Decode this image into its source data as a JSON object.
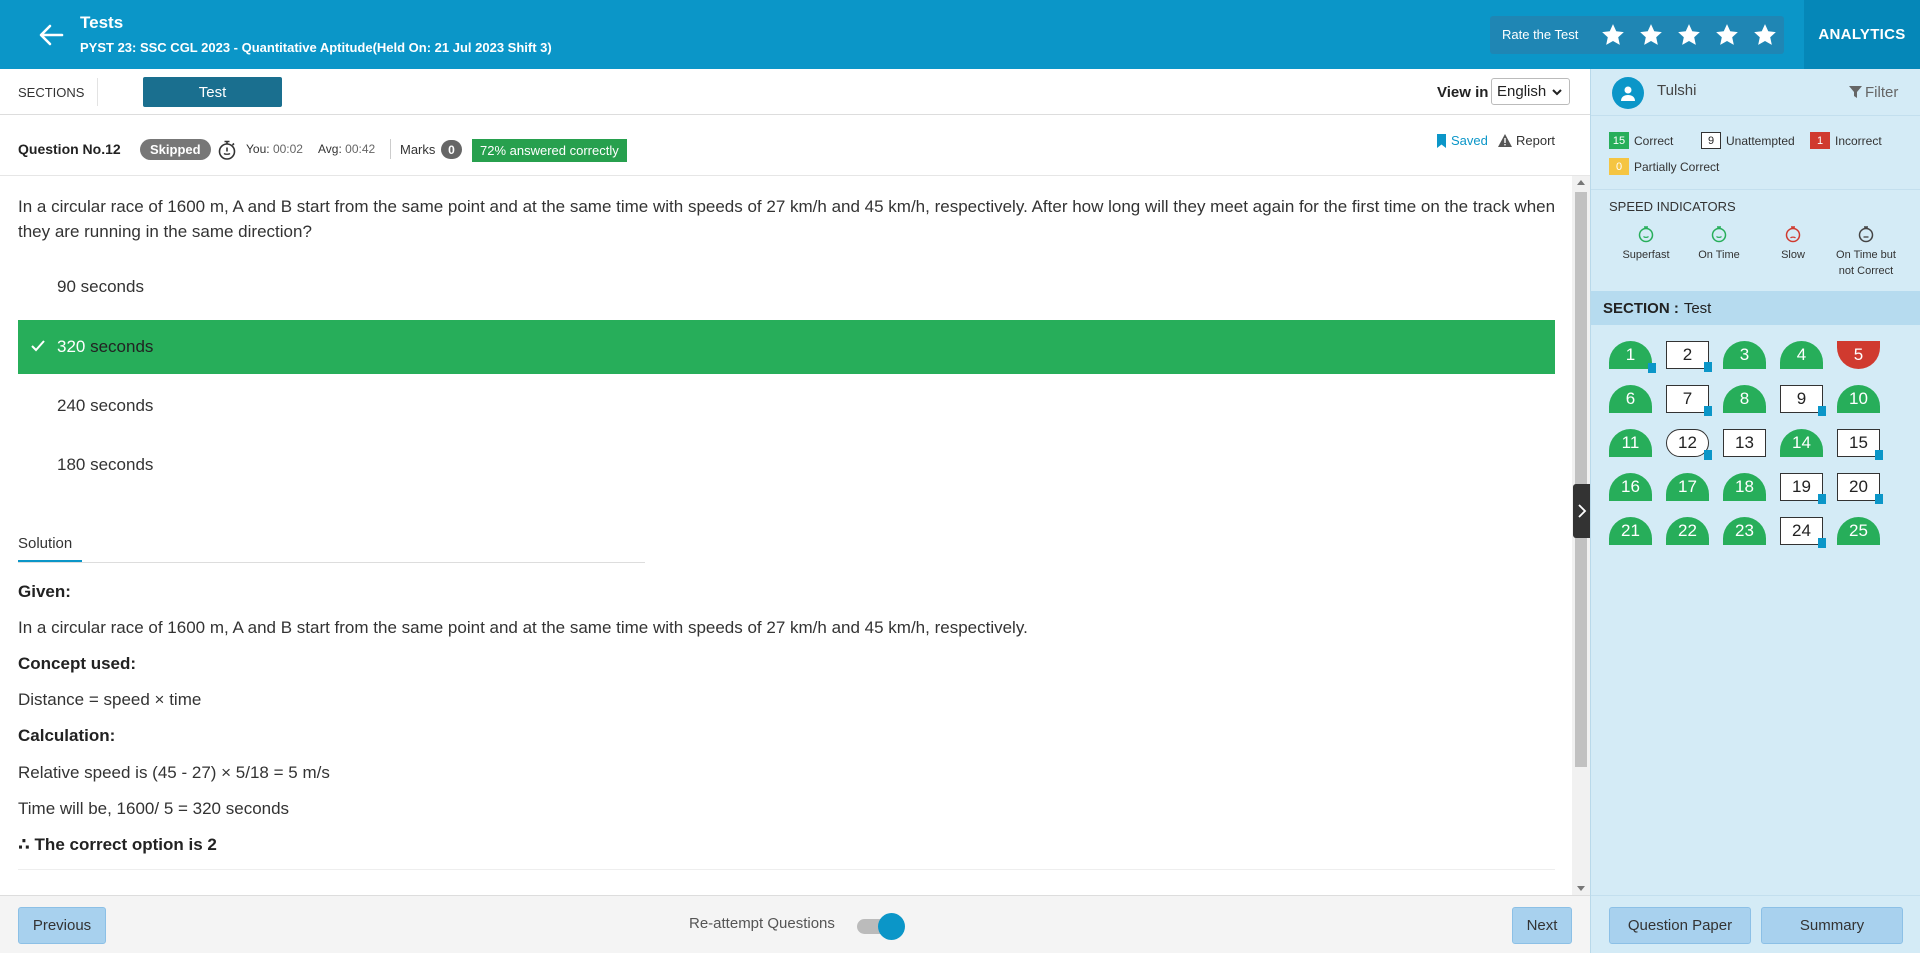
{
  "header": {
    "title": "Tests",
    "subtitle": "PYST 23: SSC CGL 2023 - Quantitative Aptitude(Held On: 21 Jul 2023 Shift 3)",
    "rate_label": "Rate the Test",
    "analytics_label": "ANALYTICS",
    "bg_color": "#0b96c8"
  },
  "sections_bar": {
    "label": "SECTIONS",
    "tab": "Test",
    "view_in_label": "View in",
    "language": "English"
  },
  "question_info": {
    "number_label": "Question No.12",
    "status": "Skipped",
    "you_label": "You:",
    "you_time": "00:02",
    "avg_label": "Avg:",
    "avg_time": "00:42",
    "marks_label": "Marks",
    "marks_value": "0",
    "percent_correct": "72% answered correctly",
    "saved_label": "Saved",
    "report_label": "Report"
  },
  "question": {
    "text": "In a circular race of 1600 m, A and B start from the same point and at the same time with speeds of 27 km/h and 45 km/h, respectively. After how long will they meet again for the first time on the track when they are running in the same direction?",
    "options": [
      {
        "text": "90 seconds",
        "correct": false
      },
      {
        "text_num": "320",
        "text_rest": " seconds",
        "correct": true
      },
      {
        "text": "240 seconds",
        "correct": false
      },
      {
        "text": "180 seconds",
        "correct": false
      }
    ]
  },
  "solution": {
    "tab_label": "Solution",
    "given_label": "Given:",
    "given_text": "In a circular race of 1600 m, A and B start from the same point and at the same time with speeds of 27 km/h and 45 km/h, respectively.",
    "concept_label": "Concept used:",
    "concept_text": "Distance = speed × time",
    "calc_label": "Calculation:",
    "calc_line1": "Relative speed is (45 - 27) × 5/18 = 5 m/s",
    "calc_line2": "Time will be, 1600/ 5 = 320 seconds",
    "answer": "∴ The correct option is 2"
  },
  "footer": {
    "previous": "Previous",
    "reattempt_label": "Re-attempt Questions",
    "next": "Next"
  },
  "right_panel": {
    "user_name": "Tulshi",
    "filter_label": "Filter",
    "legend": {
      "correct_count": "15",
      "correct_label": "Correct",
      "unattempted_count": "9",
      "unattempted_label": "Unattempted",
      "incorrect_count": "1",
      "incorrect_label": "Incorrect",
      "partial_count": "0",
      "partial_label": "Partially Correct"
    },
    "speed_title": "SPEED INDICATORS",
    "speed": {
      "superfast": "Superfast",
      "ontime": "On Time",
      "slow": "Slow",
      "ontime_wrong_1": "On Time but",
      "ontime_wrong_2": "not Correct"
    },
    "section_label": "SECTION :",
    "section_name": "Test",
    "question_paper": "Question Paper",
    "summary": "Summary",
    "colors": {
      "correct": "#27ae5a",
      "incorrect": "#d03a2f",
      "partial": "#f5c542",
      "accent": "#0b96c8"
    }
  },
  "question_grid": [
    {
      "n": "1",
      "s": "correct",
      "bm": true
    },
    {
      "n": "2",
      "s": "unatt",
      "bm": true
    },
    {
      "n": "3",
      "s": "correct",
      "bm": false
    },
    {
      "n": "4",
      "s": "correct",
      "bm": false
    },
    {
      "n": "5",
      "s": "incorrect",
      "bm": false
    },
    {
      "n": "6",
      "s": "correct",
      "bm": false
    },
    {
      "n": "7",
      "s": "unatt",
      "bm": true
    },
    {
      "n": "8",
      "s": "correct",
      "bm": false
    },
    {
      "n": "9",
      "s": "unatt",
      "bm": true
    },
    {
      "n": "10",
      "s": "correct",
      "bm": false
    },
    {
      "n": "11",
      "s": "correct",
      "bm": false
    },
    {
      "n": "12",
      "s": "current",
      "bm": true
    },
    {
      "n": "13",
      "s": "unatt",
      "bm": false
    },
    {
      "n": "14",
      "s": "correct",
      "bm": false
    },
    {
      "n": "15",
      "s": "unatt",
      "bm": true
    },
    {
      "n": "16",
      "s": "correct",
      "bm": false
    },
    {
      "n": "17",
      "s": "correct",
      "bm": false
    },
    {
      "n": "18",
      "s": "correct",
      "bm": false
    },
    {
      "n": "19",
      "s": "unatt",
      "bm": true
    },
    {
      "n": "20",
      "s": "unatt",
      "bm": true
    },
    {
      "n": "21",
      "s": "correct",
      "bm": false
    },
    {
      "n": "22",
      "s": "correct",
      "bm": false
    },
    {
      "n": "23",
      "s": "correct",
      "bm": false
    },
    {
      "n": "24",
      "s": "unatt",
      "bm": true
    },
    {
      "n": "25",
      "s": "correct",
      "bm": false
    }
  ]
}
